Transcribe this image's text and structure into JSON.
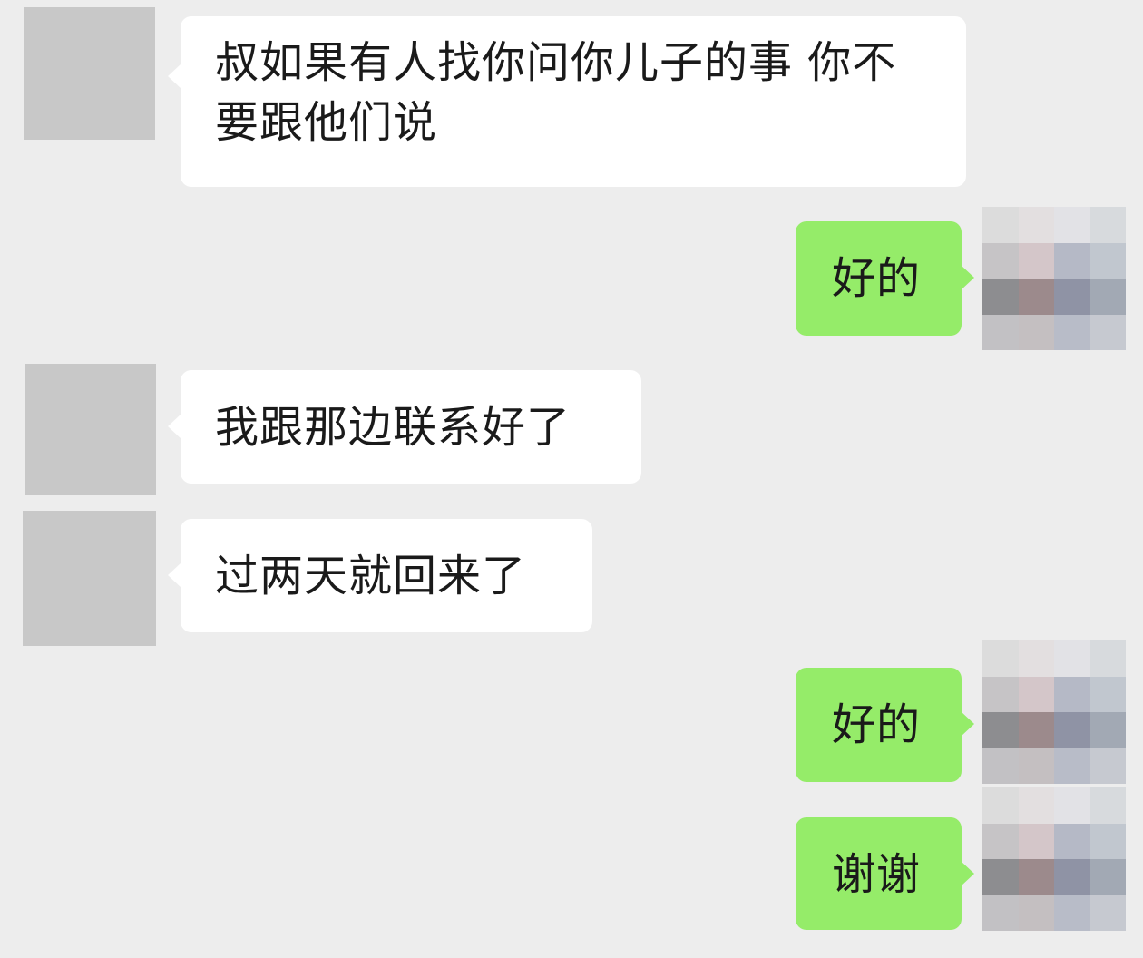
{
  "colors": {
    "background": "#ededed",
    "incoming_bubble": "#ffffff",
    "outgoing_bubble": "#95ec69",
    "avatar_placeholder": "#c8c8c8"
  },
  "messages": [
    {
      "direction": "incoming",
      "text": "叔如果有人找你问你儿子的事 你不要跟他们说"
    },
    {
      "direction": "outgoing",
      "text": "好的"
    },
    {
      "direction": "incoming",
      "text": "我跟那边联系好了"
    },
    {
      "direction": "incoming",
      "text": "过两天就回来了"
    },
    {
      "direction": "outgoing",
      "text": "好的"
    },
    {
      "direction": "outgoing",
      "text": "谢谢"
    }
  ],
  "own_avatar_mosaic": [
    "#dcdcdc",
    "#e3dfe0",
    "#e2e2e6",
    "#d7dadd",
    "#c6c4c6",
    "#d4c6c9",
    "#b5b9c6",
    "#c1c7cf",
    "#8d8d90",
    "#9c8a8c",
    "#8f93a5",
    "#a2a9b4",
    "#c2c1c4",
    "#c4bfc1",
    "#b8bcc8",
    "#c6c9d0"
  ]
}
